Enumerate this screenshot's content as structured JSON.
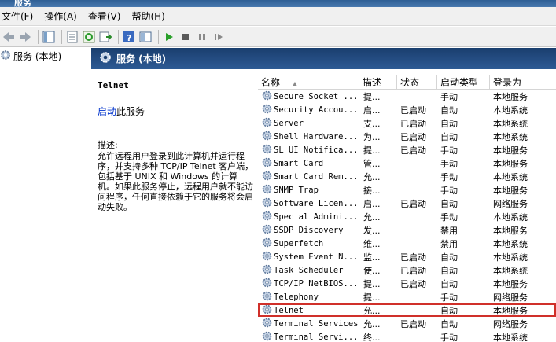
{
  "window": {
    "title": "服务"
  },
  "menu": [
    "文件(F)",
    "操作(A)",
    "查看(V)",
    "帮助(H)"
  ],
  "toolbar": {
    "icons": [
      "back-icon",
      "forward-icon",
      "console-tree-icon",
      "properties-icon",
      "refresh-icon",
      "export-icon",
      "help-icon",
      "view-icon",
      "start-icon",
      "stop-icon",
      "pause-icon",
      "resume-icon"
    ]
  },
  "tree": {
    "root_label": "服务 (本地)"
  },
  "header": {
    "title": "服务 (本地)"
  },
  "detail": {
    "service_name": "Telnet",
    "start_link": "启动",
    "start_suffix": "此服务",
    "desc_label": "描述:",
    "desc_text": "允许远程用户登录到此计算机并运行程序，并支持多种 TCP/IP Telnet 客户端，包括基于 UNIX 和 Windows 的计算机。如果此服务停止，远程用户就不能访问程序，任何直接依赖于它的服务将会启动失败。"
  },
  "columns": {
    "name": "名称",
    "desc": "描述",
    "status": "状态",
    "startup": "启动类型",
    "logon": "登录为"
  },
  "services": [
    {
      "name": "Secure Socket ...",
      "desc": "提...",
      "status": "",
      "startup": "手动",
      "logon": "本地服务"
    },
    {
      "name": "Security Accou...",
      "desc": "启...",
      "status": "已启动",
      "startup": "自动",
      "logon": "本地系统"
    },
    {
      "name": "Server",
      "desc": "支...",
      "status": "已启动",
      "startup": "自动",
      "logon": "本地系统"
    },
    {
      "name": "Shell Hardware...",
      "desc": "为...",
      "status": "已启动",
      "startup": "自动",
      "logon": "本地系统"
    },
    {
      "name": "SL UI Notifica...",
      "desc": "提...",
      "status": "已启动",
      "startup": "手动",
      "logon": "本地服务"
    },
    {
      "name": "Smart Card",
      "desc": "管...",
      "status": "",
      "startup": "手动",
      "logon": "本地服务"
    },
    {
      "name": "Smart Card Rem...",
      "desc": "允...",
      "status": "",
      "startup": "手动",
      "logon": "本地系统"
    },
    {
      "name": "SNMP Trap",
      "desc": "接...",
      "status": "",
      "startup": "手动",
      "logon": "本地服务"
    },
    {
      "name": "Software Licen...",
      "desc": "启...",
      "status": "已启动",
      "startup": "自动",
      "logon": "网络服务"
    },
    {
      "name": "Special Admini...",
      "desc": "允...",
      "status": "",
      "startup": "手动",
      "logon": "本地系统"
    },
    {
      "name": "SSDP Discovery",
      "desc": "发...",
      "status": "",
      "startup": "禁用",
      "logon": "本地服务"
    },
    {
      "name": "Superfetch",
      "desc": "维...",
      "status": "",
      "startup": "禁用",
      "logon": "本地系统"
    },
    {
      "name": "System Event N...",
      "desc": "监...",
      "status": "已启动",
      "startup": "自动",
      "logon": "本地系统"
    },
    {
      "name": "Task Scheduler",
      "desc": "使...",
      "status": "已启动",
      "startup": "自动",
      "logon": "本地系统"
    },
    {
      "name": "TCP/IP NetBIOS...",
      "desc": "提...",
      "status": "已启动",
      "startup": "自动",
      "logon": "本地服务"
    },
    {
      "name": "Telephony",
      "desc": "提...",
      "status": "",
      "startup": "手动",
      "logon": "网络服务"
    },
    {
      "name": "Telnet",
      "desc": "允...",
      "status": "",
      "startup": "自动",
      "logon": "本地服务",
      "selected": true
    },
    {
      "name": "Terminal Services",
      "desc": "允...",
      "status": "已启动",
      "startup": "自动",
      "logon": "网络服务"
    },
    {
      "name": "Terminal Servi...",
      "desc": "终...",
      "status": "",
      "startup": "手动",
      "logon": "本地系统"
    }
  ]
}
